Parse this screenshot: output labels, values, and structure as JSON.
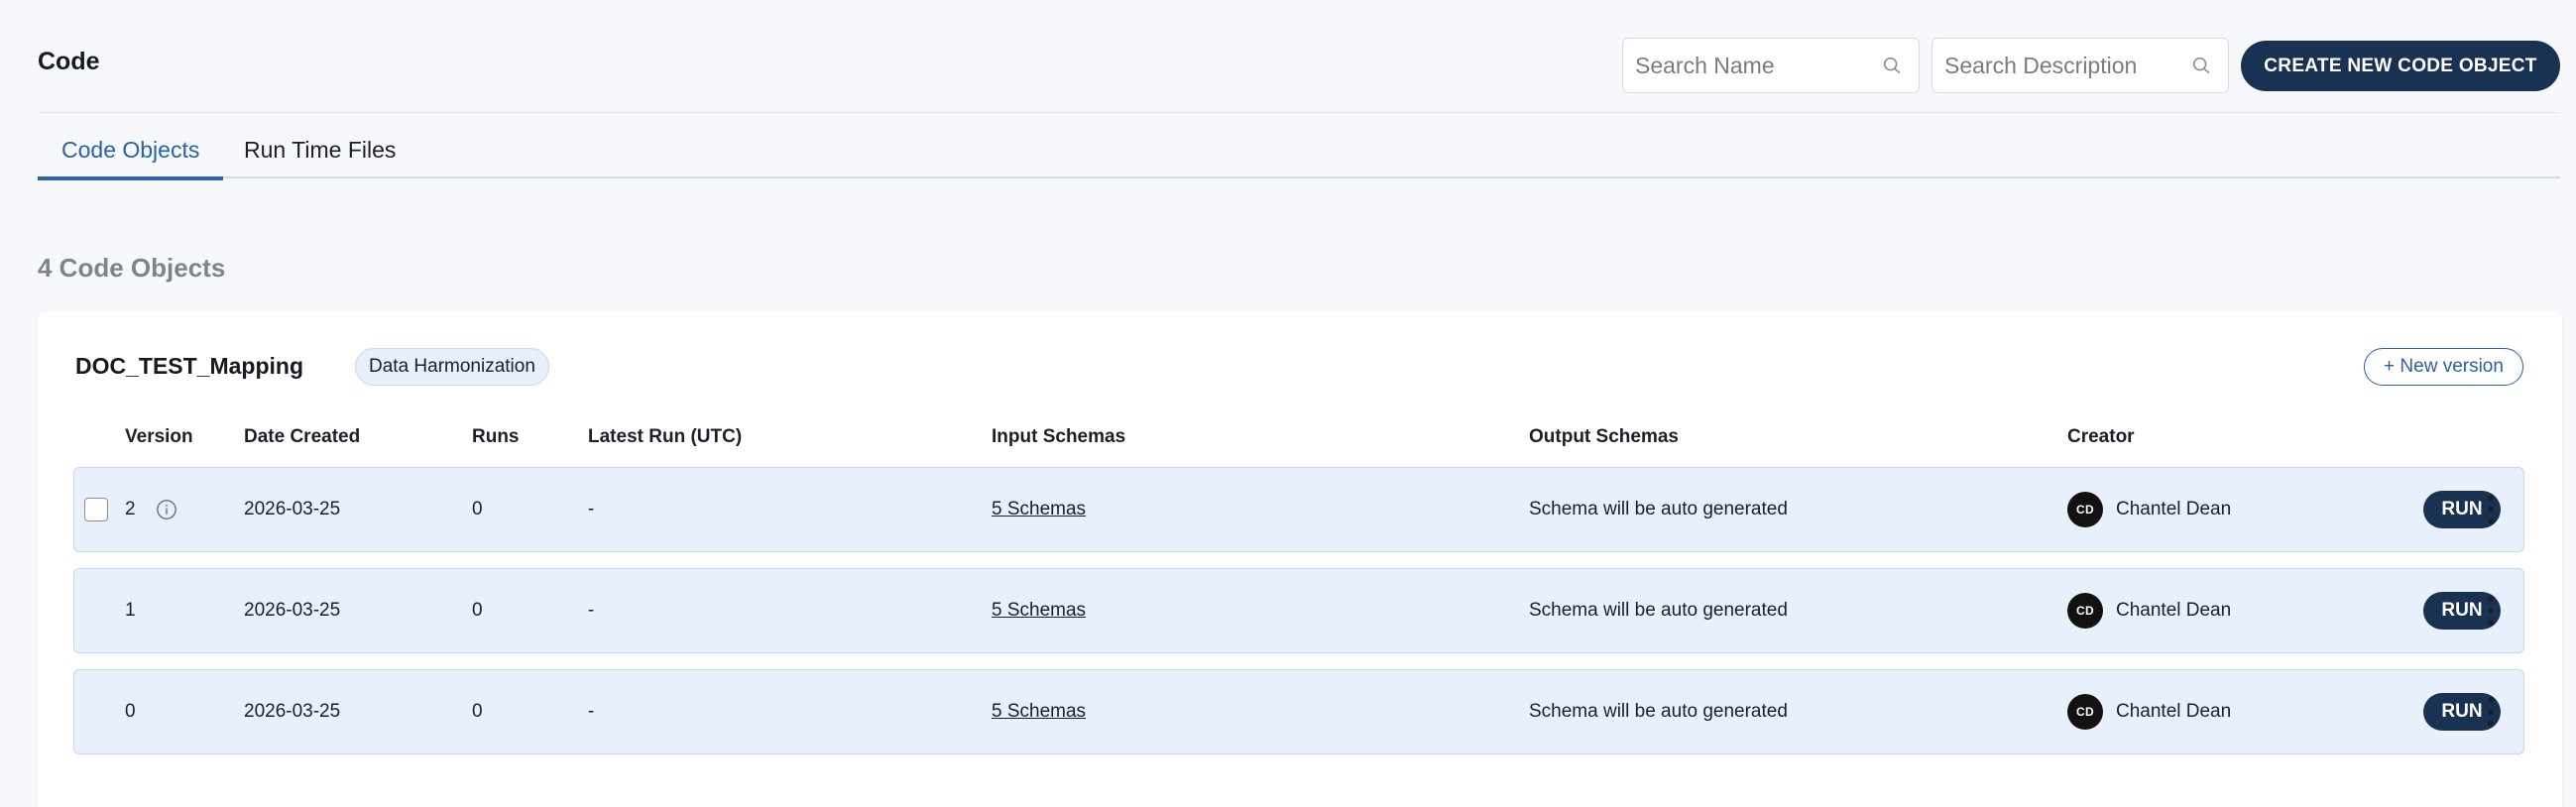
{
  "header": {
    "title": "Code",
    "search_name_placeholder": "Search Name",
    "search_description_placeholder": "Search Description",
    "create_button_label": "CREATE NEW CODE OBJECT"
  },
  "tabs": [
    {
      "label": "Code Objects",
      "active": true
    },
    {
      "label": "Run Time Files",
      "active": false
    }
  ],
  "list": {
    "count_label": "4 Code Objects"
  },
  "code_object": {
    "name": "DOC_TEST_Mapping",
    "tag": "Data Harmonization",
    "new_version_label": "+ New version",
    "columns": {
      "version": "Version",
      "date_created": "Date Created",
      "runs": "Runs",
      "latest_run": "Latest Run (UTC)",
      "input_schemas": "Input Schemas",
      "output_schemas": "Output Schemas",
      "creator": "Creator"
    },
    "rows": [
      {
        "version": "2",
        "date_created": "2026-03-25",
        "runs": "0",
        "latest_run": "-",
        "input_schemas": "5 Schemas",
        "output_schemas": "Schema will be auto generated",
        "creator_initials": "CD",
        "creator_name": "Chantel Dean",
        "run_label": "RUN"
      },
      {
        "version": "1",
        "date_created": "2026-03-25",
        "runs": "0",
        "latest_run": "-",
        "input_schemas": "5 Schemas",
        "output_schemas": "Schema will be auto generated",
        "creator_initials": "CD",
        "creator_name": "Chantel Dean",
        "run_label": "RUN"
      },
      {
        "version": "0",
        "date_created": "2026-03-25",
        "runs": "0",
        "latest_run": "-",
        "input_schemas": "5 Schemas",
        "output_schemas": "Schema will be auto generated",
        "creator_initials": "CD",
        "creator_name": "Chantel Dean",
        "run_label": "RUN"
      }
    ]
  },
  "colors": {
    "accent": "#2a61a7",
    "primary_button": "#1a3252",
    "row_background": "#e8f1fb",
    "page_background": "#f6f8fb"
  },
  "icons": [
    "search-icon",
    "info-icon",
    "kebab-menu-icon"
  ]
}
